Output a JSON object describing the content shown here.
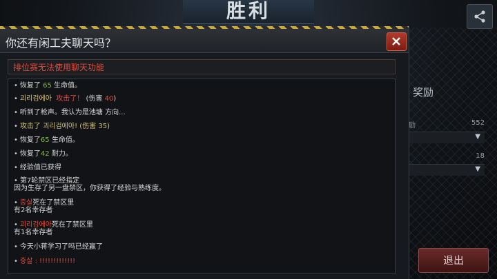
{
  "header": {
    "victory_title": "胜利"
  },
  "share": {
    "icon": "share-icon"
  },
  "reward": {
    "label": "奖励",
    "rows": [
      {
        "label": "励",
        "value": "552"
      },
      {
        "label": "",
        "value": "18"
      }
    ]
  },
  "exit": {
    "label": "退出"
  },
  "dialog": {
    "title": "你还有闲工夫聊天吗？",
    "close_icon": "close-icon",
    "notice": "排位赛无法使用聊天功能",
    "log": [
      {
        "parts": [
          "恢复了",
          "65",
          "生命值。"
        ]
      },
      {
        "parts": [
          "괴리검에아",
          "攻击了！",
          "(伤害",
          "40",
          ")"
        ]
      },
      {
        "parts": [
          "听到了枪声。我认为是池塘 方向..."
        ]
      },
      {
        "parts": [
          "攻击了 괴리검에아! (伤害 35)"
        ]
      },
      {
        "parts": [
          "恢复了",
          "65",
          "生命值。"
        ]
      },
      {
        "parts": [
          "恢复了",
          "42",
          "耐力。"
        ]
      },
      {
        "parts": [
          "经验值已获得"
        ]
      },
      {
        "parts": [
          "第7轮禁区已经指定",
          "因为生存了另一盘禁区，你获得了经验与熟练度。"
        ]
      },
      {
        "parts": [
          "중살",
          "死在了禁区里",
          "有2名幸存者"
        ]
      },
      {
        "parts": [
          "괴리검에아",
          "死在了禁区里",
          "有1名幸存者"
        ]
      },
      {
        "parts": [
          "今天小蒋学习了吗已经赢了"
        ]
      },
      {
        "parts": [
          "중살 : !!!!!!!!!!!!!"
        ]
      }
    ]
  },
  "colors": {
    "green": "#7fbf3f",
    "red": "#e24a3a",
    "gold": "#c8a93a"
  }
}
